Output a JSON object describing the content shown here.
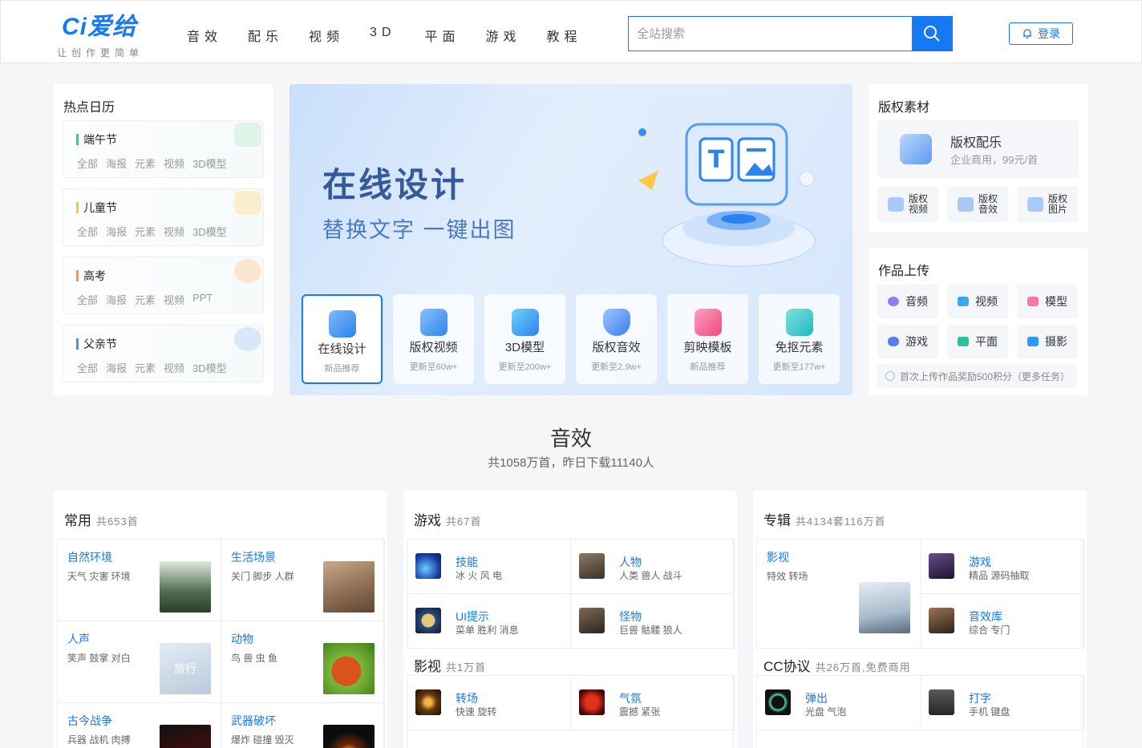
{
  "header": {
    "logo_text": "Ci爱给",
    "slogan": "让创作更简单",
    "nav": [
      "音效",
      "配乐",
      "视频",
      "3D",
      "平面",
      "游戏",
      "教程"
    ],
    "search_placeholder": "全站搜索",
    "login_label": "登录"
  },
  "calendar": {
    "title": "热点日历",
    "items": [
      {
        "name": "端午节",
        "tags": [
          "全部",
          "海报",
          "元素",
          "视频",
          "3D模型"
        ],
        "color": "#2ecc9a"
      },
      {
        "name": "儿童节",
        "tags": [
          "全部",
          "海报",
          "元素",
          "视频",
          "3D模型"
        ],
        "color": "#f5c542"
      },
      {
        "name": "高考",
        "tags": [
          "全部",
          "海报",
          "元素",
          "视频",
          "PPT"
        ],
        "color": "#f59a42"
      },
      {
        "name": "父亲节",
        "tags": [
          "全部",
          "海报",
          "元素",
          "视频",
          "3D模型"
        ],
        "color": "#4a90e2"
      }
    ]
  },
  "hero": {
    "title": "在线设计",
    "subtitle": "替换文字 一键出图",
    "cards": [
      {
        "name": "在线设计",
        "sub": "新品推荐"
      },
      {
        "name": "版权视频",
        "sub": "更新至60w+"
      },
      {
        "name": "3D模型",
        "sub": "更新至200w+"
      },
      {
        "name": "版权音效",
        "sub": "更新至2.9w+"
      },
      {
        "name": "剪映模板",
        "sub": "新品推荐"
      },
      {
        "name": "免抠元素",
        "sub": "更新至177w+"
      }
    ]
  },
  "copyright": {
    "title": "版权素材",
    "main_name": "版权配乐",
    "main_desc": "企业商用，99元/首",
    "links": [
      {
        "l1": "版权",
        "l2": "视频"
      },
      {
        "l1": "版权",
        "l2": "音效"
      },
      {
        "l1": "版权",
        "l2": "图片"
      }
    ]
  },
  "upload": {
    "title": "作品上传",
    "items": [
      "音频",
      "视频",
      "模型",
      "游戏",
      "平面",
      "摄影"
    ],
    "tip": "首次上传作品奖励500积分（更多任务）"
  },
  "section": {
    "title": "音效",
    "subtitle": "共1058万首，昨日下载11140人"
  },
  "common": {
    "title": "常用",
    "count": "共653首",
    "cells": [
      {
        "name": "自然环境",
        "desc": "天气 灾害 环境"
      },
      {
        "name": "生活场景",
        "desc": "关门 脚步 人群"
      },
      {
        "name": "人声",
        "desc": "笑声 鼓掌 对白"
      },
      {
        "name": "动物",
        "desc": "鸟 兽 虫 鱼"
      },
      {
        "name": "古今战争",
        "desc": "兵器 战机 肉搏"
      },
      {
        "name": "武器破坏",
        "desc": "爆炸 碰撞 毁灭"
      }
    ],
    "thumb_text": "旅行"
  },
  "game": {
    "title": "游戏",
    "count": "共67首",
    "rows": [
      {
        "name": "技能",
        "desc": "冰 火 风 电"
      },
      {
        "name": "人物",
        "desc": "人类 兽人 战斗"
      },
      {
        "name": "UI提示",
        "desc": "菜单 胜利 消息"
      },
      {
        "name": "怪物",
        "desc": "巨兽 骷髅 狼人"
      }
    ],
    "film_title": "影视",
    "film_count": "共1万首",
    "film_rows": [
      {
        "name": "转场",
        "desc": "快速 旋转"
      },
      {
        "name": "气氛",
        "desc": "震撼 紧张"
      }
    ]
  },
  "album": {
    "title": "专辑",
    "count": "共4134套116万首",
    "big": {
      "name": "影视",
      "desc": "特效 转场"
    },
    "rows": [
      {
        "name": "游戏",
        "desc": "精品 源码抽取"
      },
      {
        "name": "音效库",
        "desc": "综合 专门"
      }
    ],
    "cc_title": "CC协议",
    "cc_count": "共26万首,免费商用",
    "cc_rows": [
      {
        "name": "弹出",
        "desc": "光盘 气泡"
      },
      {
        "name": "打字",
        "desc": "手机 键盘"
      }
    ]
  },
  "colors": {
    "accent": "#1479f2",
    "link": "#1479f2"
  }
}
